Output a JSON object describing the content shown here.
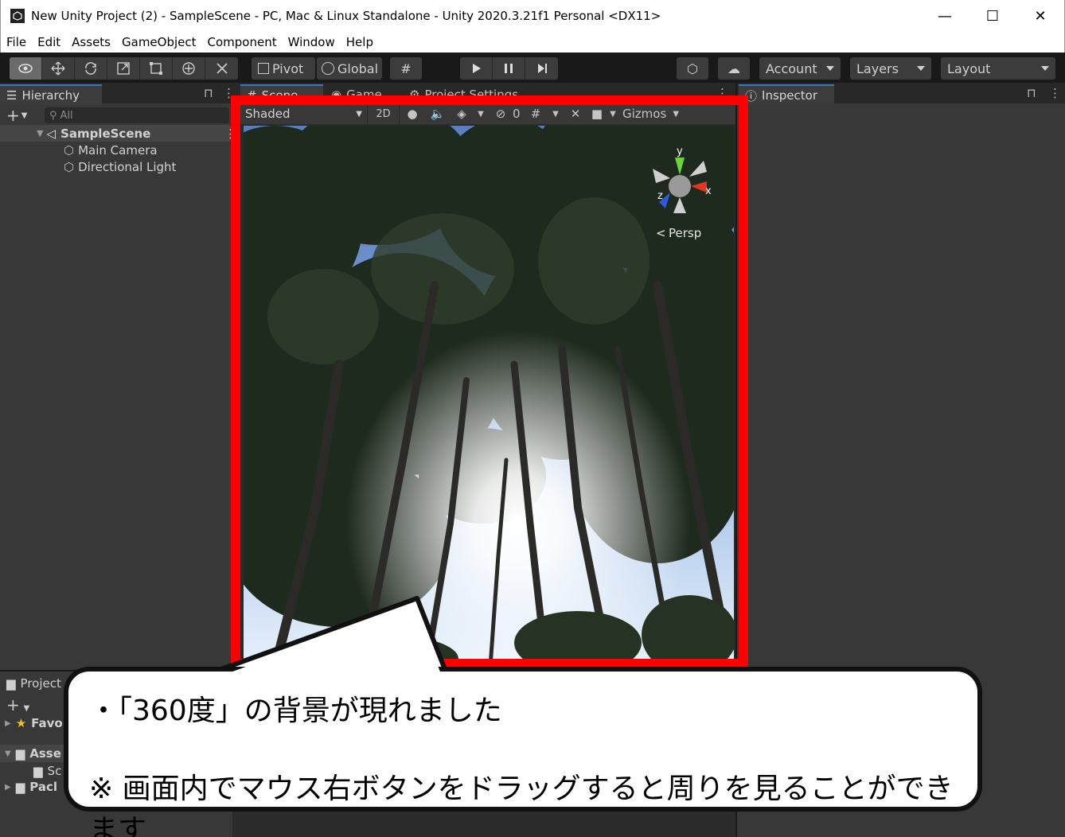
{
  "window": {
    "title": "New Unity Project (2) - SampleScene - PC, Mac & Linux Standalone - Unity 2020.3.21f1 Personal <DX11>",
    "minimize": "—",
    "maximize": "☐",
    "close": "✕"
  },
  "menu": [
    "File",
    "Edit",
    "Assets",
    "GameObject",
    "Component",
    "Window",
    "Help"
  ],
  "toolbar": {
    "pivot_label": "Pivot",
    "global_label": "Global",
    "account_label": "Account",
    "layers_label": "Layers",
    "layout_label": "Layout"
  },
  "hierarchy": {
    "tab_label": "Hierarchy",
    "search_placeholder": "All",
    "scene_name": "SampleScene",
    "items": [
      "Main Camera",
      "Directional Light"
    ]
  },
  "scene_tabs": {
    "scene": "Scene",
    "game": "Game",
    "project_settings": "Project Settings"
  },
  "scene_toolbar": {
    "shading_mode": "Shaded",
    "mode_2d": "2D",
    "hidden_count": "0",
    "gizmos_label": "Gizmos"
  },
  "gizmo": {
    "x_label": "x",
    "y_label": "y",
    "z_label": "z",
    "projection_label": "Persp"
  },
  "inspector": {
    "tab_label": "Inspector"
  },
  "project": {
    "tab_label": "Project",
    "favorites": "Favo",
    "assets": "Asse",
    "scenes": "Sc",
    "packages": "Pacl"
  },
  "callout": {
    "line1": "・「360度」の背景が現れました",
    "line2": "※ 画面内でマウス右ボタンをドラッグすると周りを見ることができます"
  },
  "colors": {
    "highlight_frame": "#ff0000",
    "tab_accent": "#3a79bb"
  }
}
